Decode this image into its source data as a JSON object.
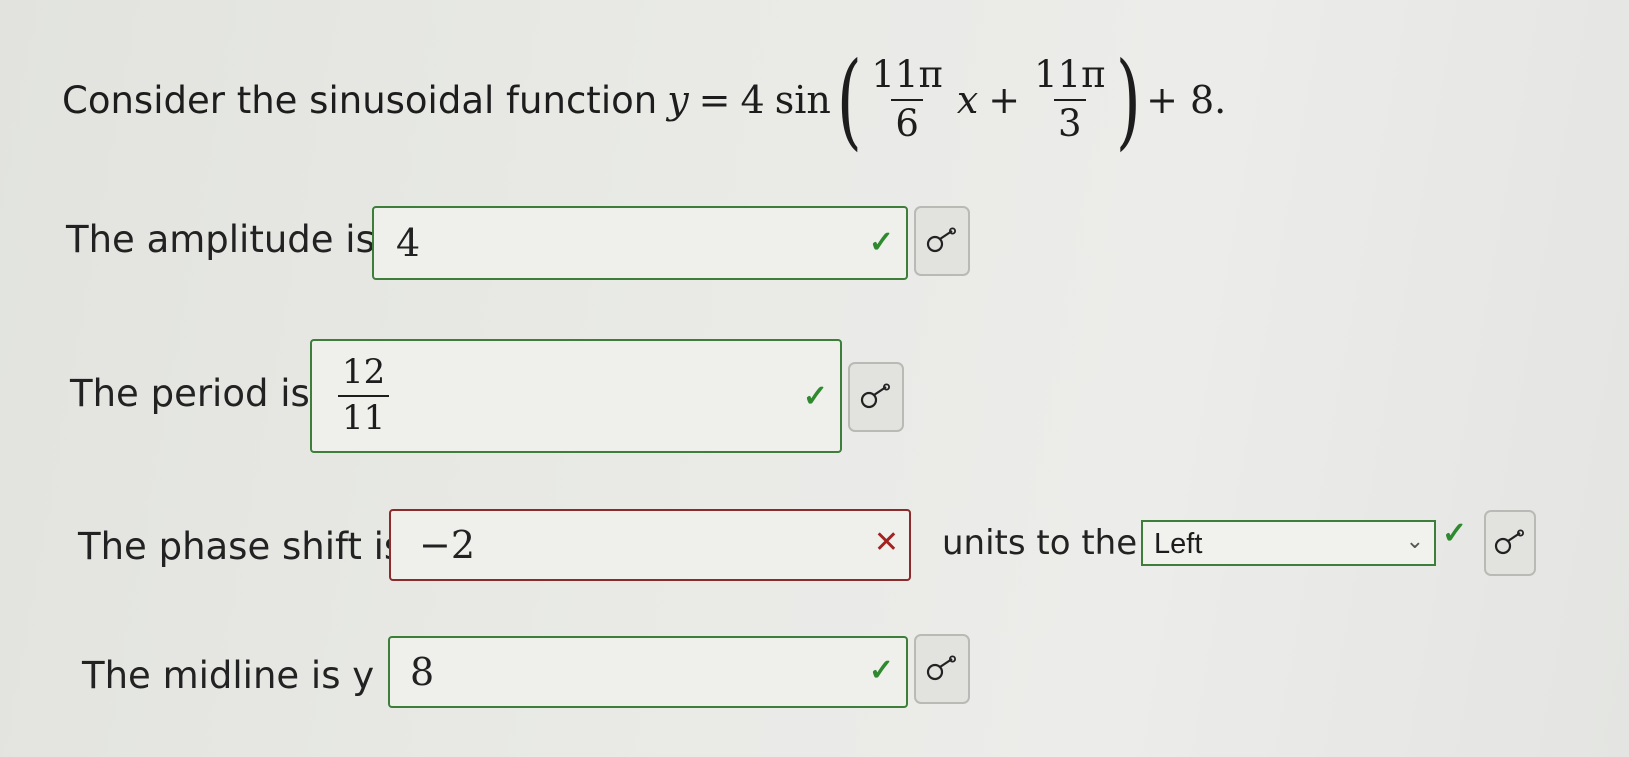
{
  "question": {
    "lead": "Consider the sinusoidal function",
    "y": "y",
    "equals": "=",
    "coef": "4",
    "func": "sin",
    "open_paren": "(",
    "frac1_num": "11π",
    "frac1_den": "6",
    "var": "x",
    "plus1": "+",
    "frac2_num": "11π",
    "frac2_den": "3",
    "close_paren": ")",
    "tail": "+ 8."
  },
  "amplitude": {
    "label": "The amplitude is",
    "value": "4",
    "status": "correct"
  },
  "period": {
    "label": "The period is",
    "num": "12",
    "den": "11",
    "status": "correct"
  },
  "phase_shift": {
    "label": "The phase shift is",
    "value": "−2",
    "status": "incorrect",
    "units_label": "units to the",
    "direction": "Left",
    "direction_status": "correct"
  },
  "midline": {
    "label": "The midline is y =",
    "value": "8",
    "status": "correct"
  },
  "icons": {
    "check": "✓",
    "cross": "✕",
    "dropdown": "⌄",
    "key": "key-icon"
  },
  "colors": {
    "correct": "#3d7f3a",
    "incorrect": "#8c2b2b"
  }
}
